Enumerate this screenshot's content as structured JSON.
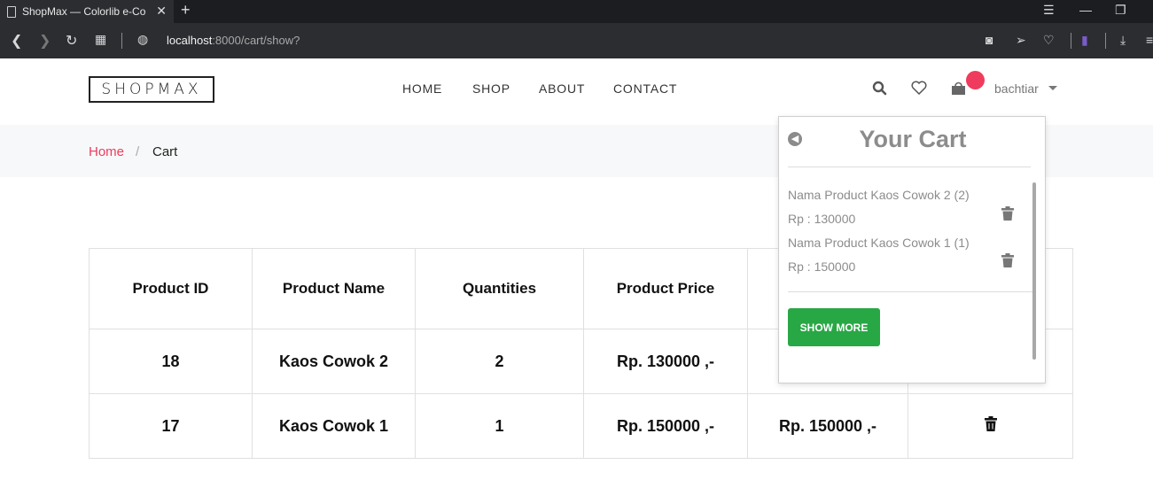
{
  "browser": {
    "tab_title": "ShopMax — Colorlib e-Commerce",
    "url_host": "localhost",
    "url_rest": ":8000/cart/show?"
  },
  "site": {
    "logo": "SHOPMAX",
    "menu": [
      "HOME",
      "SHOP",
      "ABOUT",
      "CONTACT"
    ],
    "user": "bachtiar",
    "accent_color": "#ef3b5d"
  },
  "breadcrumb": {
    "home": "Home",
    "separator": "/",
    "current": "Cart"
  },
  "cart_table": {
    "headers": [
      "Product ID",
      "Product Name",
      "Quantities",
      "Product Price",
      "",
      ""
    ],
    "rows": [
      [
        "18",
        "Kaos Cowok 2",
        "2",
        "Rp. 130000 ,-",
        "",
        ""
      ],
      [
        "17",
        "Kaos Cowok 1",
        "1",
        "Rp. 150000 ,-",
        "Rp. 150000 ,-",
        ""
      ]
    ]
  },
  "cart_popup": {
    "title": "Your Cart",
    "items": [
      {
        "name": "Nama Product Kaos Cowok 2 (2)",
        "price": "Rp : 130000"
      },
      {
        "name": "Nama Product Kaos Cowok 1 (1)",
        "price": "Rp : 150000"
      }
    ],
    "button": "SHOW MORE",
    "button_color": "#28a745"
  }
}
